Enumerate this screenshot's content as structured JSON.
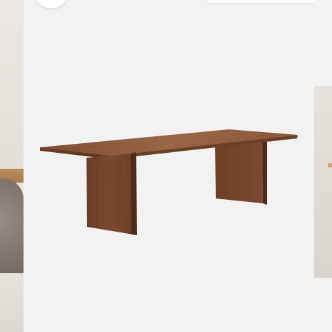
{
  "gallery": {
    "main_image": {
      "subject": "walnut-dining-table"
    },
    "prev_image": {
      "subject": "boucle-chair-and-table"
    },
    "next_image": {
      "subject": "product-photo"
    }
  },
  "colors": {
    "background": "#f3f3f3",
    "wood_top": "#8a5638",
    "wood_leg": "#6f3f27",
    "wood_leg_dark": "#5a321f"
  }
}
